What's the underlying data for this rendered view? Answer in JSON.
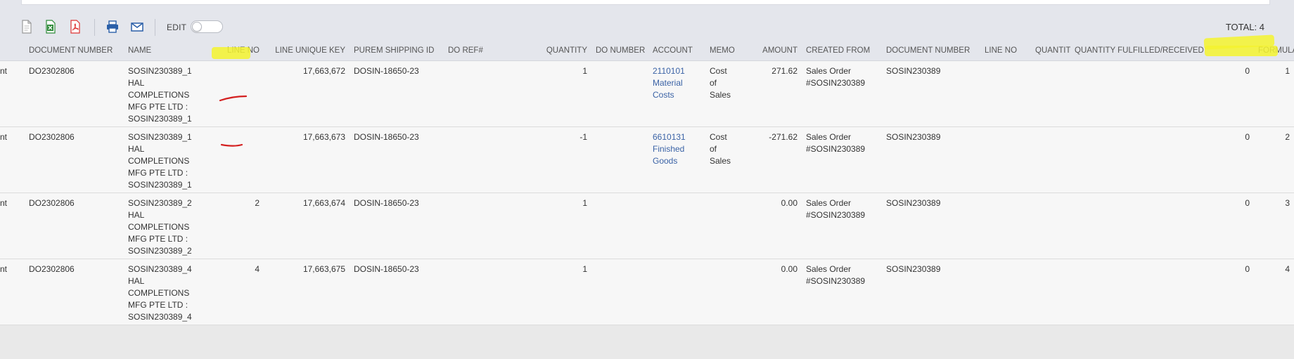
{
  "toolbar": {
    "icons": [
      "document-icon",
      "excel-icon",
      "pdf-icon",
      "print-icon",
      "email-icon"
    ],
    "edit_label": "EDIT",
    "total_label": "TOTAL: 4"
  },
  "columns": [
    "",
    "DOCUMENT NUMBER",
    "NAME",
    "LINE NO",
    "LINE UNIQUE KEY",
    "PUREM SHIPPING ID",
    "DO REF#",
    "QUANTITY",
    "DO NUMBER",
    "ACCOUNT",
    "MEMO",
    "AMOUNT",
    "CREATED FROM",
    "DOCUMENT NUMBER",
    "LINE NO",
    "QUANTITY",
    "QUANTITY FULFILLED/RECEIVED",
    "FORMULA (NUMERIC)"
  ],
  "rows": [
    {
      "type": "nt",
      "doc": "DO2302806",
      "name": "SOSIN230389_1 HAL COMPLETIONS MFG PTE LTD : SOSIN230389_1",
      "line": "",
      "key": "17,663,672",
      "ship": "DOSIN-18650-23",
      "doref": "",
      "qty": "1",
      "donum": "",
      "account": "2110101 Material Costs",
      "memo": "Cost of Sales",
      "amount": "271.62",
      "created": "Sales Order #SOSIN230389",
      "docnum2": "SOSIN230389",
      "line2": "",
      "qty2": "",
      "fulfilled": "0",
      "formula": "1"
    },
    {
      "type": "nt",
      "doc": "DO2302806",
      "name": "SOSIN230389_1 HAL COMPLETIONS MFG PTE LTD : SOSIN230389_1",
      "line": "",
      "key": "17,663,673",
      "ship": "DOSIN-18650-23",
      "doref": "",
      "qty": "-1",
      "donum": "",
      "account": "6610131 Finished Goods",
      "memo": "Cost of Sales",
      "amount": "-271.62",
      "created": "Sales Order #SOSIN230389",
      "docnum2": "SOSIN230389",
      "line2": "",
      "qty2": "",
      "fulfilled": "0",
      "formula": "2"
    },
    {
      "type": "nt",
      "doc": "DO2302806",
      "name": "SOSIN230389_2 HAL COMPLETIONS MFG PTE LTD : SOSIN230389_2",
      "line": "2",
      "key": "17,663,674",
      "ship": "DOSIN-18650-23",
      "doref": "",
      "qty": "1",
      "donum": "",
      "account": "",
      "memo": "",
      "amount": "0.00",
      "created": "Sales Order #SOSIN230389",
      "docnum2": "SOSIN230389",
      "line2": "",
      "qty2": "",
      "fulfilled": "0",
      "formula": "3"
    },
    {
      "type": "nt",
      "doc": "DO2302806",
      "name": "SOSIN230389_4 HAL COMPLETIONS MFG PTE LTD : SOSIN230389_4",
      "line": "4",
      "key": "17,663,675",
      "ship": "DOSIN-18650-23",
      "doref": "",
      "qty": "1",
      "donum": "",
      "account": "",
      "memo": "",
      "amount": "0.00",
      "created": "Sales Order #SOSIN230389",
      "docnum2": "SOSIN230389",
      "line2": "",
      "qty2": "",
      "fulfilled": "0",
      "formula": "4"
    }
  ],
  "colors": {
    "link": "#3b63a6",
    "highlight": "#f5f32f",
    "annotation": "#d42020",
    "header_bg": "#e4e6ec"
  }
}
